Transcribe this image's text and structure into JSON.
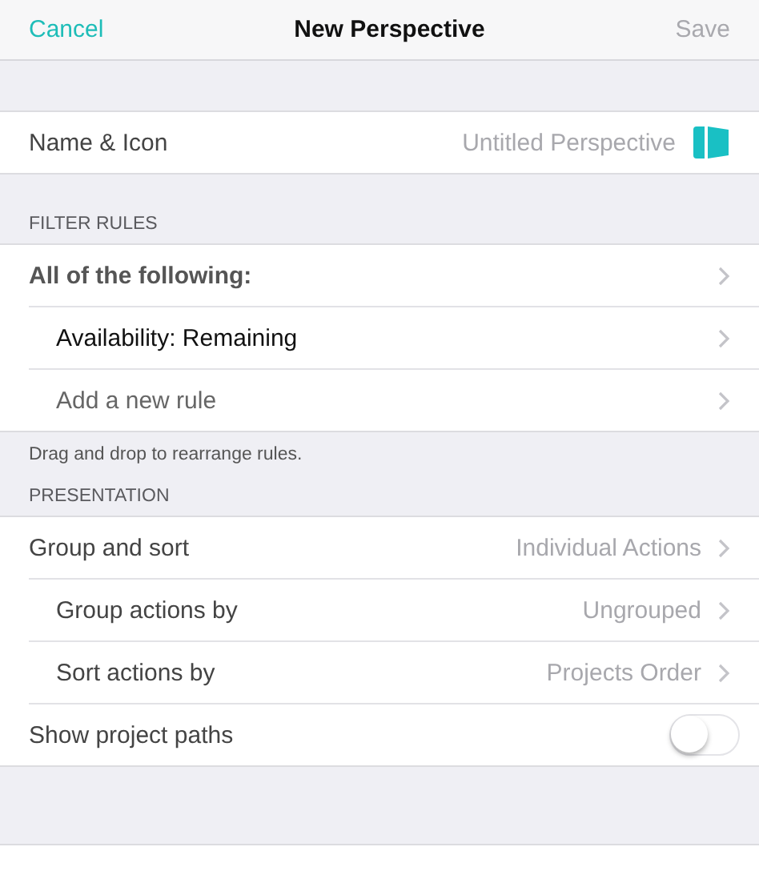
{
  "nav": {
    "cancel": "Cancel",
    "title": "New Perspective",
    "save": "Save",
    "save_disabled": true
  },
  "sections": [
    {
      "rows": [
        {
          "kind": "icon",
          "label": "Name & Icon",
          "value": "Untitled Perspective"
        }
      ]
    },
    {
      "header": "FILTER RULES",
      "rows": [
        {
          "kind": "group",
          "label": "All of the following:",
          "children": [
            {
              "kind": "disclosure",
              "label": "Availability: Remaining"
            },
            {
              "kind": "add",
              "label": "Add a new rule"
            }
          ]
        }
      ],
      "footer": "Drag and drop to rearrange rules."
    },
    {
      "header": "PRESENTATION",
      "rows": [
        {
          "kind": "disclosure",
          "label": "Group and sort",
          "value": "Individual Actions",
          "children": [
            {
              "kind": "disclosure",
              "label": "Group actions by",
              "value": "Ungrouped"
            },
            {
              "kind": "disclosure",
              "label": "Sort actions by",
              "value": "Projects Order"
            }
          ]
        },
        {
          "kind": "toggle",
          "label": "Show project paths",
          "on": false
        }
      ]
    }
  ]
}
